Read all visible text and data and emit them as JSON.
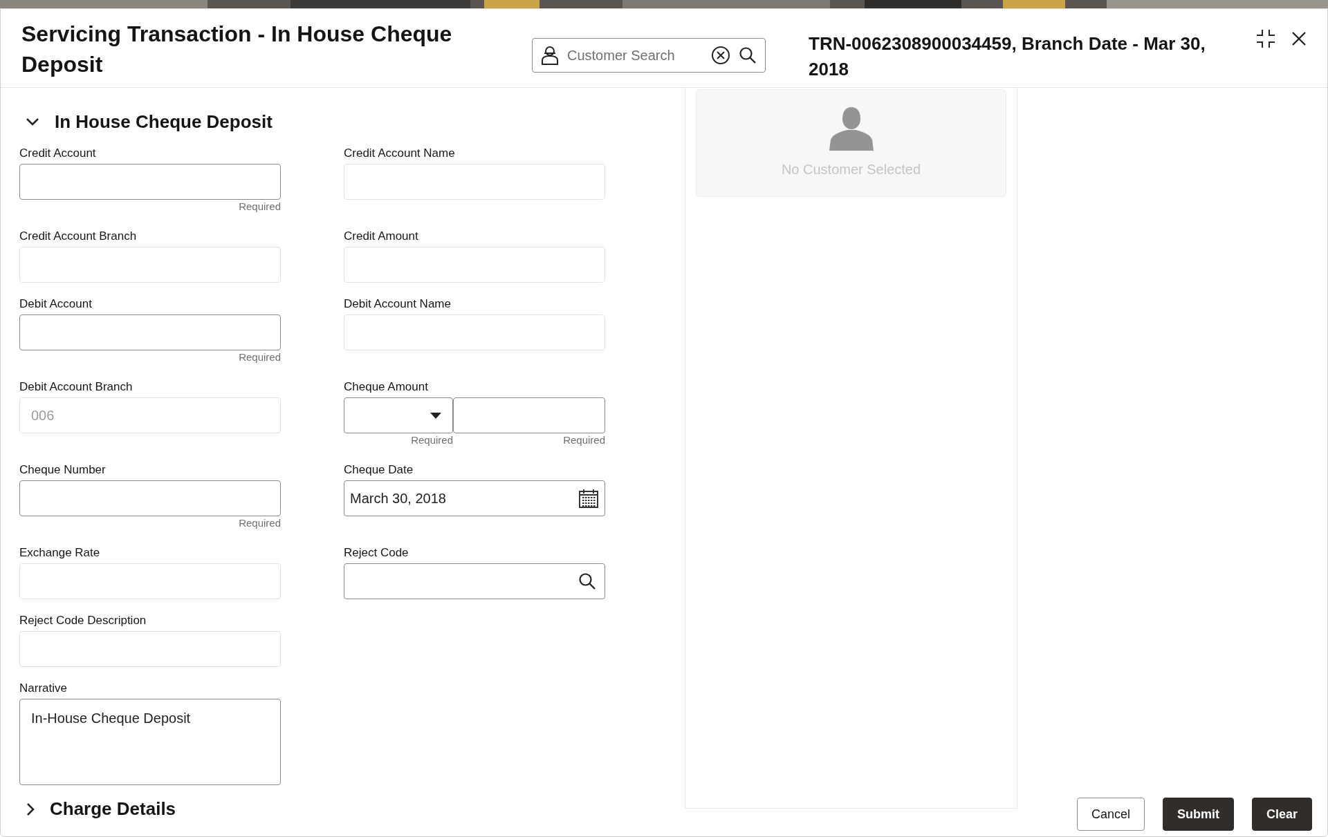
{
  "window": {
    "title": "Servicing Transaction - In House Cheque Deposit",
    "reference": "TRN-0062308900034459, Branch Date - Mar 30, 2018"
  },
  "customer_search": {
    "placeholder": "Customer Search"
  },
  "section": {
    "title": "In House Cheque Deposit",
    "expanded": true
  },
  "rows": [
    [
      {
        "label": "Credit Account",
        "kind": "text",
        "disabled": false,
        "notes": [
          "Required"
        ]
      },
      {
        "label": "Credit Account Name",
        "kind": "text",
        "disabled": true
      }
    ],
    [
      {
        "label": "Credit Account Branch",
        "kind": "text",
        "disabled": true
      },
      {
        "label": "Credit Amount",
        "kind": "text",
        "disabled": true
      }
    ],
    [
      {
        "label": "Debit Account",
        "kind": "text",
        "disabled": false,
        "notes": [
          "Required"
        ]
      },
      {
        "label": "Debit Account Name",
        "kind": "text",
        "disabled": true
      }
    ],
    [
      {
        "label": "Debit Account Branch",
        "kind": "text",
        "disabled": true,
        "value": "006"
      },
      {
        "label": "Cheque Amount",
        "kind": "amount",
        "disabled": false,
        "notes": [
          "Required",
          "Required"
        ]
      }
    ],
    [
      {
        "label": "Cheque Number",
        "kind": "text",
        "disabled": false,
        "notes": [
          "Required"
        ]
      },
      {
        "label": "Cheque Date",
        "kind": "date",
        "disabled": false,
        "value": "March 30, 2018"
      }
    ],
    [
      {
        "label": "Exchange Rate",
        "kind": "text",
        "disabled": true
      },
      {
        "label": "Reject Code",
        "kind": "search",
        "disabled": false
      }
    ],
    [
      {
        "label": "Reject Code Description",
        "kind": "text",
        "disabled": true
      }
    ],
    [
      {
        "label": "Narrative",
        "kind": "textarea",
        "disabled": false,
        "value": "In-House Cheque Deposit"
      }
    ]
  ],
  "charge_section": {
    "title": "Charge Details",
    "expanded": false
  },
  "customer_card": {
    "message": "No Customer Selected"
  },
  "buttons": [
    {
      "label": "Cancel",
      "kind": "secondary"
    },
    {
      "label": "Submit",
      "kind": "primary"
    },
    {
      "label": "Clear",
      "kind": "primary"
    }
  ]
}
